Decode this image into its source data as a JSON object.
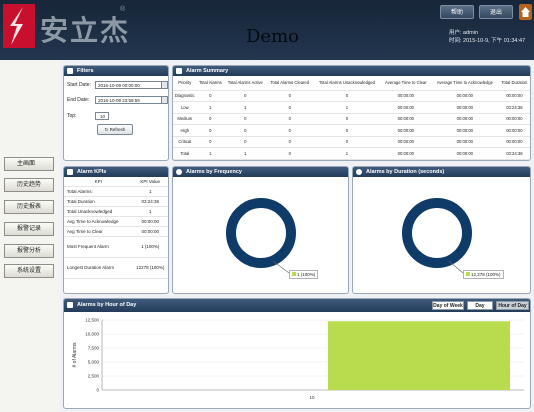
{
  "header": {
    "logo_text": "安立杰",
    "registered_mark": "®",
    "title": "Demo",
    "buttons": [
      "帮助",
      "退出"
    ],
    "user_label": "用户: admin",
    "time_label": "时间: 2015-10-9, 下午 01:34:47"
  },
  "sidebar": {
    "items": [
      "主画面",
      "历史趋势",
      "历史报表",
      "报警记录",
      "报警分析",
      "系统设置"
    ]
  },
  "filters": {
    "title": "Filters",
    "start_label": "Start Date:",
    "start_value": "2016-10-09 00:00:00",
    "end_label": "End Date:",
    "end_value": "2016-10-09 23:59:59",
    "top_label": "Top:",
    "top_value": "10",
    "refresh": "Refresh"
  },
  "summary": {
    "title": "Alarm Summary",
    "headers": [
      "Priority",
      "Total Alarms",
      "Total Alarms Active",
      "Total Alarms Cleared",
      "Total Alarms Unacknowledged",
      "Average Time to Clear",
      "Average Time to Acknowledge",
      "Total Duration"
    ],
    "rows": [
      [
        "Diagnostic",
        "0",
        "0",
        "0",
        "0",
        "00:00:00",
        "00:00:00",
        "00:00:00"
      ],
      [
        "Low",
        "1",
        "1",
        "0",
        "1",
        "00:00:00",
        "00:00:00",
        "03:24:38"
      ],
      [
        "Medium",
        "0",
        "0",
        "0",
        "0",
        "00:00:00",
        "00:00:00",
        "00:00:00"
      ],
      [
        "High",
        "0",
        "0",
        "0",
        "0",
        "00:00:00",
        "00:00:00",
        "00:00:00"
      ],
      [
        "Critical",
        "0",
        "0",
        "0",
        "0",
        "00:00:00",
        "00:00:00",
        "00:00:00"
      ],
      [
        "Total",
        "1",
        "1",
        "0",
        "1",
        "00:00:00",
        "00:00:00",
        "03:24:38"
      ]
    ]
  },
  "kpis": {
    "title": "Alarm KPIs",
    "headers": [
      "KPI",
      "KPI Value"
    ],
    "rows": [
      [
        "Total Alarms:",
        "1"
      ],
      [
        "Total Duration",
        "03:24:38"
      ],
      [
        "Total Unacknowledged",
        "1"
      ],
      [
        "Avg Time to Acknowledge",
        "00:00:00"
      ],
      [
        "Avg Time to Clear",
        "00:00:00"
      ],
      [
        "Most Frequent Alarm",
        "1 (100%)"
      ],
      [
        "Longest Duration Alarm",
        "12278 (100%)"
      ]
    ]
  },
  "freq": {
    "title": "Alarms by Frequency",
    "legend": "1 (100%)"
  },
  "duration": {
    "title": "Alarms by Duration (seconds)",
    "legend": "12,278 (100%)"
  },
  "hour": {
    "title": "Alarms by Hour of Day",
    "tabs": [
      "Day of Week",
      "Day",
      "Hour of Day"
    ],
    "ylabel": "# of Alarms"
  },
  "colors": {
    "accent": "#223b59",
    "donut": "#0f3b68",
    "bar": "#b8dc4d"
  },
  "chart_data": [
    {
      "type": "pie",
      "title": "Alarms by Frequency",
      "labels": [
        "1"
      ],
      "values": [
        1
      ]
    },
    {
      "type": "pie",
      "title": "Alarms by Duration (seconds)",
      "labels": [
        "1"
      ],
      "values": [
        12278
      ]
    },
    {
      "type": "bar",
      "title": "Alarms by Hour of Day",
      "categories": [
        "10"
      ],
      "values": [
        12278
      ],
      "ylabel": "# of Alarms",
      "ylim": [
        0,
        12500
      ],
      "yticks": [
        0,
        2500,
        5000,
        7500,
        10000,
        12500
      ],
      "ytick_labels": [
        "0",
        "2,500",
        "5,000",
        "7,500",
        "10,000",
        "12,500"
      ]
    }
  ]
}
